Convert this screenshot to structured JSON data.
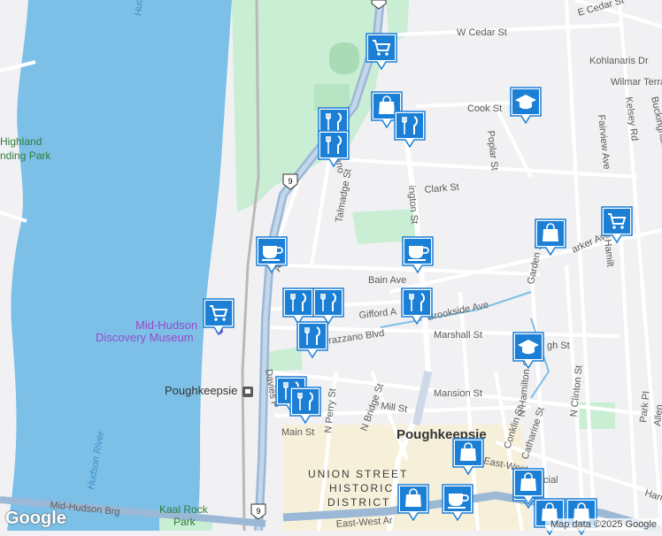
{
  "map": {
    "colors": {
      "water": "#7cc0e8",
      "land": "#f1f1f4",
      "park": "#c9eed3",
      "road": "#ffffff",
      "highway": "#9bb8d6",
      "district": "#f7efd2",
      "marker": "#1b7fd6"
    },
    "streets": {
      "e_cedar": "E Cedar St",
      "w_cedar": "W Cedar St",
      "kohlanaris": "Kohlanaris Dr",
      "wilmar": "Wilmar Terrace",
      "buckingham": "Buckingham Ave",
      "cook": "Cook St",
      "kelsey": "Kelsey Rd",
      "fairview": "Fairview Ave",
      "poplar": "Poplar St",
      "clark": "Clark St",
      "delano": "Delano",
      "talmadge": "Talmadge St",
      "washington": "ington St",
      "albany": "Alb",
      "bain": "Bain Ave",
      "parker": "arker Ave",
      "n_hamilton_top": "N Hamilt",
      "garden": "Garden St",
      "gifford": "Gifford A",
      "brookside": "Brookside Ave",
      "verrazzano": "errazzano Blvd",
      "marshall": "Marshall St",
      "high": "gh St",
      "davies": "Davies P",
      "n_perry": "N Perry St",
      "n_bridge": "N Bridge St",
      "mansion": "Mansion St",
      "mill": "Mill St",
      "main": "Main St",
      "conklin": "Conklin St",
      "catharine": "Catharine St",
      "n_hamilton": "N Hamilton St",
      "n_clinton": "N Clinton St",
      "park_pl": "Park Pl",
      "allen": "Allen",
      "harr": "Harr",
      "east_west": "East-West",
      "east_west_ar": "East-West Ar",
      "cial": "cial",
      "mid_hudson_brg": "Mid-Hudson Brg",
      "route_9": "9"
    },
    "places": {
      "highland_1": "Highland",
      "highland_2": "nding Park",
      "museum_1": "Mid-Hudson",
      "museum_2": "Discovery Museum",
      "station": "Poughkeepsie",
      "city": "Poughkeepsie",
      "district_1": "UNION STREET",
      "district_2": "HISTORIC",
      "district_3": "DISTRICT",
      "kaal_1": "Kaal Rock",
      "kaal_2": "Park",
      "hudson_river": "Hudson River",
      "hudson_top": "Hud"
    },
    "markers": [
      {
        "icon": "cart-icon"
      },
      {
        "icon": "shopping-bag-icon"
      },
      {
        "icon": "restaurant-icon"
      },
      {
        "icon": "restaurant-icon"
      },
      {
        "icon": "restaurant-icon"
      },
      {
        "icon": "school-icon"
      },
      {
        "icon": "cart-icon"
      },
      {
        "icon": "shopping-bag-icon"
      },
      {
        "icon": "coffee-icon"
      },
      {
        "icon": "coffee-icon"
      },
      {
        "icon": "restaurant-icon"
      },
      {
        "icon": "restaurant-icon"
      },
      {
        "icon": "restaurant-icon"
      },
      {
        "icon": "restaurant-icon"
      },
      {
        "icon": "cart-icon"
      },
      {
        "icon": "restaurant-icon"
      },
      {
        "icon": "restaurant-icon"
      },
      {
        "icon": "school-icon"
      },
      {
        "icon": "shopping-bag-icon"
      },
      {
        "icon": "shopping-bag-icon"
      },
      {
        "icon": "shopping-bag-icon"
      },
      {
        "icon": "shopping-bag-icon"
      },
      {
        "icon": "coffee-icon"
      },
      {
        "icon": "shopping-bag-icon"
      },
      {
        "icon": "shopping-bag-icon"
      }
    ],
    "attribution": "Map data ©2025 Google",
    "logo": "Google"
  }
}
